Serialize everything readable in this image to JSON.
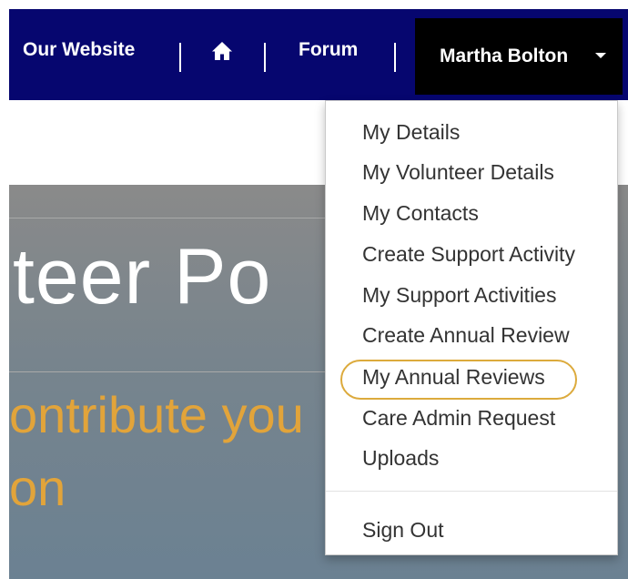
{
  "navbar": {
    "links": [
      "Our Website",
      "Forum"
    ],
    "home_icon": "home-icon",
    "user_name": "Martha Bolton",
    "caret_icon": "caret-down-icon"
  },
  "hero": {
    "title": "teer Po",
    "subtitle_line1": "ontribute you",
    "subtitle_line2": "on"
  },
  "dropdown": {
    "items": [
      "My Details",
      "My Volunteer Details",
      "My Contacts",
      "Create Support Activity",
      "My Support Activities",
      "Create Annual Review",
      "My Annual Reviews",
      "Care Admin Request",
      "Uploads"
    ],
    "sign_out": "Sign Out",
    "highlighted_item": "My Annual Reviews"
  },
  "colors": {
    "navbar_bg": "#06066f",
    "user_button_bg": "#000000",
    "hero_accent": "#e2a43a",
    "highlight_ring": "#dcaa3c"
  }
}
